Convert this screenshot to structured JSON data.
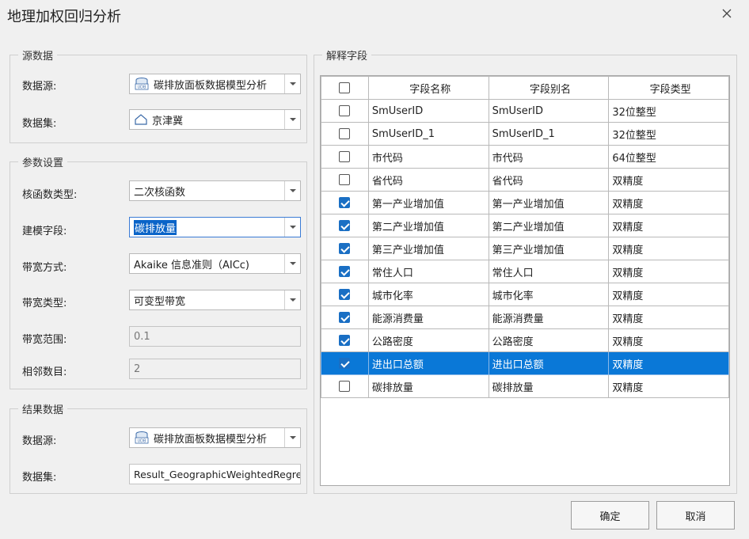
{
  "window": {
    "title": "地理加权回归分析"
  },
  "source": {
    "legend": "源数据",
    "datasource_label": "数据源:",
    "datasource_value": "碳排放面板数据模型分析",
    "dataset_label": "数据集:",
    "dataset_value": "京津冀"
  },
  "params": {
    "legend": "参数设置",
    "kernel_label": "核函数类型:",
    "kernel_value": "二次核函数",
    "field_label": "建模字段:",
    "field_value": "碳排放量",
    "bw_method_label": "带宽方式:",
    "bw_method_value": "Akaike 信息准则（AICc)",
    "bw_type_label": "带宽类型:",
    "bw_type_value": "可变型带宽",
    "bw_range_label": "带宽范围:",
    "bw_range_value": "0.1",
    "neighbors_label": "相邻数目:",
    "neighbors_value": "2"
  },
  "result": {
    "legend": "结果数据",
    "datasource_label": "数据源:",
    "datasource_value": "碳排放面板数据模型分析",
    "dataset_label": "数据集:",
    "dataset_value": "Result_GeographicWeightedRegres"
  },
  "fields_panel": {
    "legend": "解释字段",
    "headers": [
      "字段名称",
      "字段别名",
      "字段类型"
    ],
    "rows": [
      {
        "checked": false,
        "name": "SmUserID",
        "alias": "SmUserID",
        "type": "32位整型"
      },
      {
        "checked": false,
        "name": "SmUserID_1",
        "alias": "SmUserID_1",
        "type": "32位整型"
      },
      {
        "checked": false,
        "name": "市代码",
        "alias": "市代码",
        "type": "64位整型"
      },
      {
        "checked": false,
        "name": "省代码",
        "alias": "省代码",
        "type": "双精度"
      },
      {
        "checked": true,
        "name": "第一产业增加值",
        "alias": "第一产业增加值",
        "type": "双精度"
      },
      {
        "checked": true,
        "name": "第二产业增加值",
        "alias": "第二产业增加值",
        "type": "双精度"
      },
      {
        "checked": true,
        "name": "第三产业增加值",
        "alias": "第三产业增加值",
        "type": "双精度"
      },
      {
        "checked": true,
        "name": "常住人口",
        "alias": "常住人口",
        "type": "双精度"
      },
      {
        "checked": true,
        "name": "城市化率",
        "alias": "城市化率",
        "type": "双精度"
      },
      {
        "checked": true,
        "name": "能源消费量",
        "alias": "能源消费量",
        "type": "双精度"
      },
      {
        "checked": true,
        "name": "公路密度",
        "alias": "公路密度",
        "type": "双精度"
      },
      {
        "checked": true,
        "name": "进出口总额",
        "alias": "进出口总额",
        "type": "双精度",
        "selected": true
      },
      {
        "checked": false,
        "name": "碳排放量",
        "alias": "碳排放量",
        "type": "双精度"
      }
    ]
  },
  "buttons": {
    "ok": "确定",
    "cancel": "取消"
  },
  "colors": {
    "selection": "#0a78d7",
    "checkbox": "#1a6fc4"
  }
}
